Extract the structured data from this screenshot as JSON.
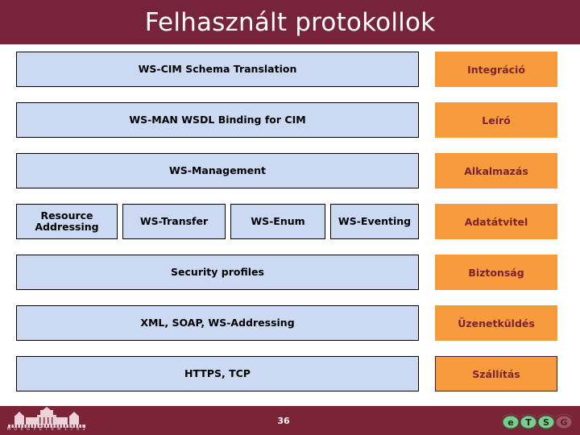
{
  "slide": {
    "title": "Felhasznált protokollok",
    "page_number": "36"
  },
  "colors": {
    "banner": "#77243a",
    "footer": "#7b2438",
    "protocol_box_fill": "#ccd9f2",
    "protocol_box_border": "#000000",
    "layer_label_fill": "#f89b3c",
    "layer_label_text": "#7a2331",
    "title_text": "#ffffff"
  },
  "diagram": {
    "rows": [
      {
        "protocols": [
          "WS-CIM Schema Translation"
        ],
        "layer_label": "Integráció"
      },
      {
        "protocols": [
          "WS-MAN WSDL Binding for CIM"
        ],
        "layer_label": "Leíró"
      },
      {
        "protocols": [
          "WS-Management"
        ],
        "layer_label": "Alkalmazás"
      },
      {
        "protocols": [
          "Resource Addressing",
          "WS-Transfer",
          "WS-Enum",
          "WS-Eventing"
        ],
        "layer_label": "Adatátvitel"
      },
      {
        "protocols": [
          "Security profiles"
        ],
        "layer_label": "Biztonság"
      },
      {
        "protocols": [
          "XML, SOAP, WS-Addressing"
        ],
        "layer_label": "Üzenetküldés"
      },
      {
        "protocols": [
          "HTTPS, TCP"
        ],
        "layer_label": "Szállítás"
      }
    ]
  },
  "footer": {
    "university_logo_caption": "M Ű E G Y E T E M   1 7 8 2",
    "university_logo_name": "bme-building-logo",
    "department_logo_name": "department-logo",
    "department_logo_letters": [
      "e",
      "T",
      "S",
      "G"
    ]
  }
}
